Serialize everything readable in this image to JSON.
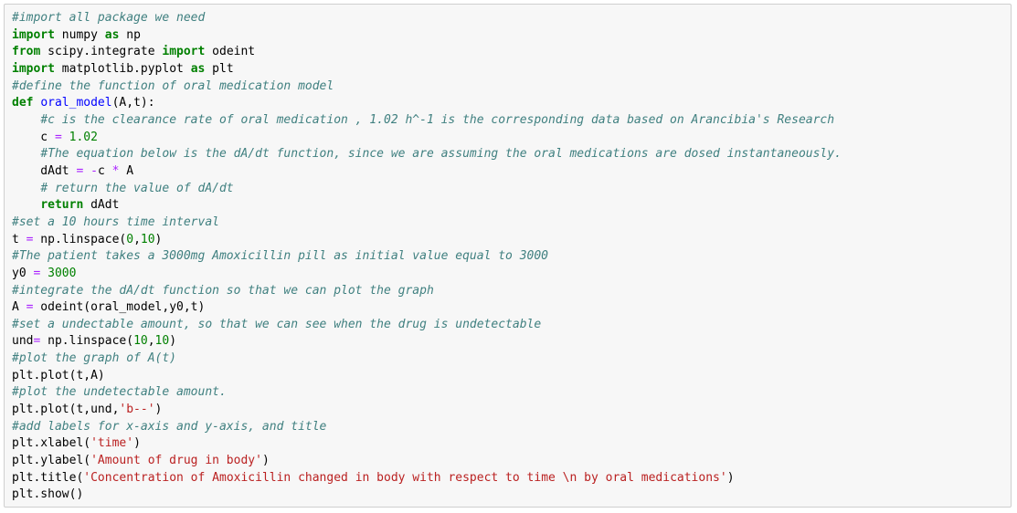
{
  "colors": {
    "comment": "#408080",
    "keyword": "#008000",
    "function_name": "#0000ff",
    "number": "#008000",
    "operator": "#aa22ff",
    "string": "#ba2121",
    "cell_background": "#f7f7f7",
    "cell_border": "#cfcfcf"
  },
  "lines": [
    [
      {
        "t": "cm",
        "s": "#import all package we need"
      }
    ],
    [
      {
        "t": "kw",
        "s": "import"
      },
      {
        "t": "tx",
        "s": " numpy "
      },
      {
        "t": "kw",
        "s": "as"
      },
      {
        "t": "tx",
        "s": " np"
      }
    ],
    [
      {
        "t": "kw",
        "s": "from"
      },
      {
        "t": "tx",
        "s": " scipy.integrate "
      },
      {
        "t": "kw",
        "s": "import"
      },
      {
        "t": "tx",
        "s": " odeint"
      }
    ],
    [
      {
        "t": "kw",
        "s": "import"
      },
      {
        "t": "tx",
        "s": " matplotlib.pyplot "
      },
      {
        "t": "kw",
        "s": "as"
      },
      {
        "t": "tx",
        "s": " plt"
      }
    ],
    [
      {
        "t": "cm",
        "s": "#define the function of oral medication model"
      }
    ],
    [
      {
        "t": "kw",
        "s": "def"
      },
      {
        "t": "tx",
        "s": " "
      },
      {
        "t": "fn",
        "s": "oral_model"
      },
      {
        "t": "tx",
        "s": "(A,t):"
      }
    ],
    [
      {
        "t": "tx",
        "s": "    "
      },
      {
        "t": "cm",
        "s": "#c is the clearance rate of oral medication , 1.02 h^-1 is the corresponding data based on Arancibia's Research"
      }
    ],
    [
      {
        "t": "tx",
        "s": "    c "
      },
      {
        "t": "op",
        "s": "="
      },
      {
        "t": "tx",
        "s": " "
      },
      {
        "t": "nu",
        "s": "1.02"
      }
    ],
    [
      {
        "t": "tx",
        "s": "    "
      },
      {
        "t": "cm",
        "s": "#The equation below is the dA/dt function, since we are assuming the oral medications are dosed instantaneously."
      }
    ],
    [
      {
        "t": "tx",
        "s": "    dAdt "
      },
      {
        "t": "op",
        "s": "="
      },
      {
        "t": "tx",
        "s": " "
      },
      {
        "t": "op",
        "s": "-"
      },
      {
        "t": "tx",
        "s": "c "
      },
      {
        "t": "op",
        "s": "*"
      },
      {
        "t": "tx",
        "s": " A"
      }
    ],
    [
      {
        "t": "tx",
        "s": "    "
      },
      {
        "t": "cm",
        "s": "# return the value of dA/dt"
      }
    ],
    [
      {
        "t": "tx",
        "s": "    "
      },
      {
        "t": "kw",
        "s": "return"
      },
      {
        "t": "tx",
        "s": " dAdt"
      }
    ],
    [
      {
        "t": "cm",
        "s": "#set a 10 hours time interval"
      }
    ],
    [
      {
        "t": "tx",
        "s": "t "
      },
      {
        "t": "op",
        "s": "="
      },
      {
        "t": "tx",
        "s": " np.linspace("
      },
      {
        "t": "nu",
        "s": "0"
      },
      {
        "t": "tx",
        "s": ","
      },
      {
        "t": "nu",
        "s": "10"
      },
      {
        "t": "tx",
        "s": ")"
      }
    ],
    [
      {
        "t": "cm",
        "s": "#The patient takes a 3000mg Amoxicillin pill as initial value equal to 3000"
      }
    ],
    [
      {
        "t": "tx",
        "s": "y0 "
      },
      {
        "t": "op",
        "s": "="
      },
      {
        "t": "tx",
        "s": " "
      },
      {
        "t": "nu",
        "s": "3000"
      }
    ],
    [
      {
        "t": "cm",
        "s": "#integrate the dA/dt function so that we can plot the graph"
      }
    ],
    [
      {
        "t": "tx",
        "s": "A "
      },
      {
        "t": "op",
        "s": "="
      },
      {
        "t": "tx",
        "s": " odeint(oral_model,y0,t)"
      }
    ],
    [
      {
        "t": "cm",
        "s": "#set a undectable amount, so that we can see when the drug is undetectable"
      }
    ],
    [
      {
        "t": "tx",
        "s": "und"
      },
      {
        "t": "op",
        "s": "="
      },
      {
        "t": "tx",
        "s": " np.linspace("
      },
      {
        "t": "nu",
        "s": "10"
      },
      {
        "t": "tx",
        "s": ","
      },
      {
        "t": "nu",
        "s": "10"
      },
      {
        "t": "tx",
        "s": ")"
      }
    ],
    [
      {
        "t": "cm",
        "s": "#plot the graph of A(t)"
      }
    ],
    [
      {
        "t": "tx",
        "s": "plt.plot(t,A)"
      }
    ],
    [
      {
        "t": "cm",
        "s": "#plot the undetectable amount."
      }
    ],
    [
      {
        "t": "tx",
        "s": "plt.plot(t,und,"
      },
      {
        "t": "st",
        "s": "'b--'"
      },
      {
        "t": "tx",
        "s": ")"
      }
    ],
    [
      {
        "t": "cm",
        "s": "#add labels for x-axis and y-axis, and title"
      }
    ],
    [
      {
        "t": "tx",
        "s": "plt.xlabel("
      },
      {
        "t": "st",
        "s": "'time'"
      },
      {
        "t": "tx",
        "s": ")"
      }
    ],
    [
      {
        "t": "tx",
        "s": "plt.ylabel("
      },
      {
        "t": "st",
        "s": "'Amount of drug in body'"
      },
      {
        "t": "tx",
        "s": ")"
      }
    ],
    [
      {
        "t": "tx",
        "s": "plt.title("
      },
      {
        "t": "st",
        "s": "'Concentration of Amoxicillin changed in body with respect to time \\n by oral medications'"
      },
      {
        "t": "tx",
        "s": ")"
      }
    ],
    [
      {
        "t": "tx",
        "s": "plt.show()"
      }
    ]
  ]
}
